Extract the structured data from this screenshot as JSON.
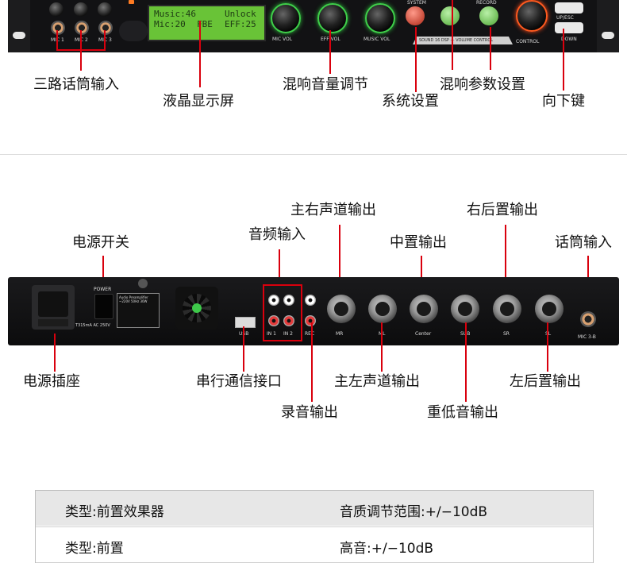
{
  "front_panel": {
    "lcd": {
      "line1_left": "Music:46",
      "line1_right": "Unlock",
      "line2_left": "Mic:20",
      "line2_mid": "FBE",
      "line2_right": "EFF:25"
    },
    "mic_jacks": [
      "MIC 1",
      "MIC 2",
      "MIC 3"
    ],
    "knob_labels": {
      "mic": "MIC VOL",
      "eff": "EFF VOL",
      "music": "MUSIC VOL",
      "control": "CONTROL"
    },
    "buttons": {
      "up": "UP/ESC",
      "down": "DOWN",
      "system": "SYSTEM",
      "record": "RECORD"
    },
    "badge": "SOUND 16 DSP — VOLUME CONTROL"
  },
  "front_labels": {
    "mic_input": "三路话筒输入",
    "lcd": "液晶显示屏",
    "mix_volume": "混响音量调节",
    "system_settings": "系统设置",
    "mix_params": "混响参数设置",
    "down_key": "向下键"
  },
  "rear_panel": {
    "power_label": "POWER",
    "fuse_label": "T315mA AC 250V",
    "preamp_label": "Audio Preamplifier ~220V 50Hz 30W",
    "usb_label": "USB",
    "in1_label": "IN 1",
    "in2_label": "IN 2",
    "rec_label": "REC",
    "xlr_labels": [
      "MR",
      "ML",
      "Center",
      "SUB",
      "SR",
      "SL"
    ],
    "mic_label": "MIC 3-B"
  },
  "rear_labels": {
    "power_switch": "电源开关",
    "audio_input": "音频输入",
    "main_right_out": "主右声道输出",
    "center_out": "中置输出",
    "rear_right_out": "右后置输出",
    "mic_input": "话筒输入",
    "power_socket": "电源插座",
    "serial_port": "串行通信接口",
    "main_left_out": "主左声道输出",
    "rear_left_out": "左后置输出",
    "record_out": "录音输出",
    "subwoofer_out": "重低音输出"
  },
  "spec_table": {
    "rows": [
      {
        "left": "类型:前置效果器",
        "right": "音质调节范围:+/−10dB"
      },
      {
        "left": "类型:前置",
        "right": "高音:+/−10dB"
      }
    ]
  }
}
